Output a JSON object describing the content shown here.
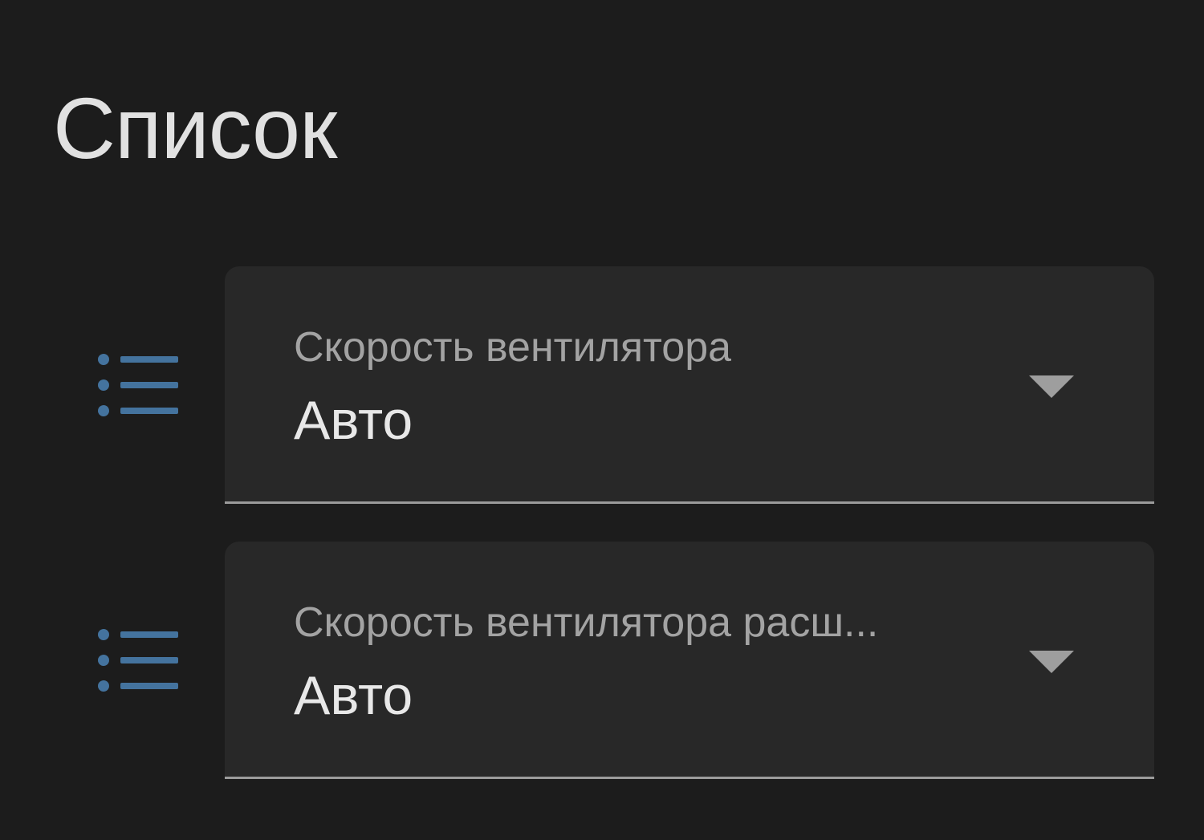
{
  "card": {
    "title": "Список"
  },
  "entities": [
    {
      "icon": "format-list-bulleted-icon",
      "label": "Скорость вентилятора",
      "value": "Авто"
    },
    {
      "icon": "format-list-bulleted-icon",
      "label": "Скорость вентилятора расш...",
      "value": "Авто"
    }
  ],
  "colors": {
    "background": "#1c1c1c",
    "field_background": "#282828",
    "icon_accent": "#44739e",
    "label_text": "#a3a3a3",
    "value_text": "#e8e8e8",
    "underline": "#9b9b9b"
  }
}
